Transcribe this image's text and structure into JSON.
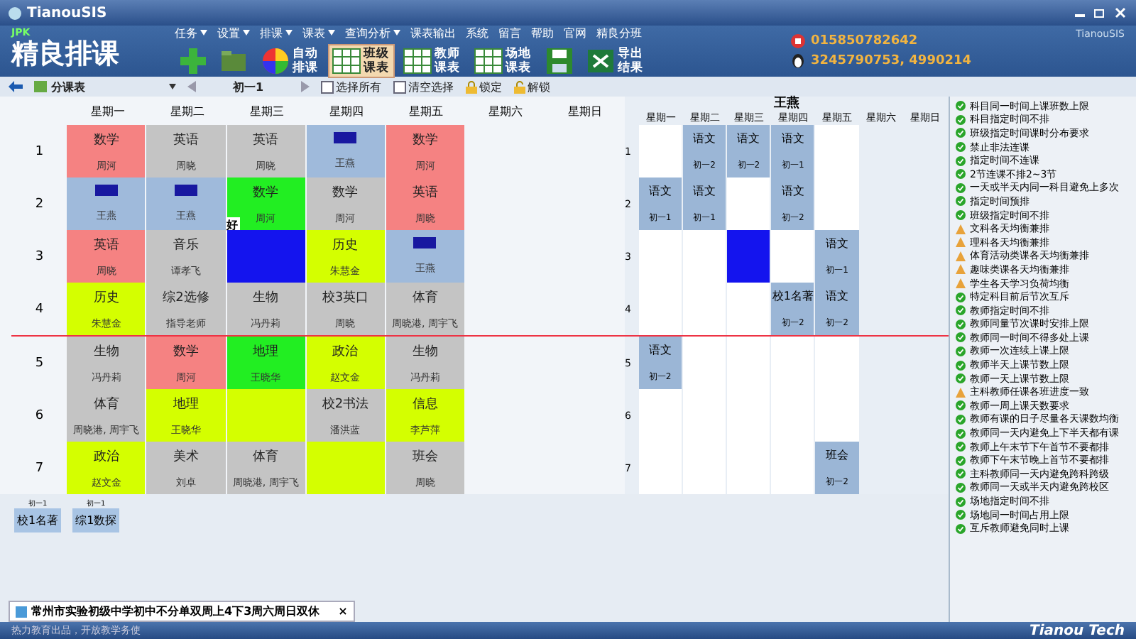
{
  "window": {
    "title": "TianouSIS",
    "title_right": "TianouSIS"
  },
  "logo": {
    "badge": "JPK",
    "name": "精良排课"
  },
  "menu": [
    {
      "label": "任务",
      "dropdown": true
    },
    {
      "label": "设置",
      "dropdown": true
    },
    {
      "label": "排课",
      "dropdown": true
    },
    {
      "label": "课表",
      "dropdown": true
    },
    {
      "label": "查询分析",
      "dropdown": true
    },
    {
      "label": "课表输出",
      "dropdown": false
    },
    {
      "label": "系统",
      "dropdown": false
    },
    {
      "label": "留言",
      "dropdown": false
    },
    {
      "label": "帮助",
      "dropdown": false
    },
    {
      "label": "官网",
      "dropdown": false
    },
    {
      "label": "精良分班",
      "dropdown": false
    }
  ],
  "toolbar": [
    {
      "kind": "add",
      "selected": false
    },
    {
      "kind": "open",
      "selected": false
    },
    {
      "kind": "auto",
      "label": "自动排课",
      "selected": false
    },
    {
      "kind": "grid",
      "label": "班级课表",
      "selected": true
    },
    {
      "kind": "grid",
      "label": "教师课表",
      "selected": false
    },
    {
      "kind": "grid",
      "label": "场地课表",
      "selected": false
    },
    {
      "kind": "save",
      "selected": false
    },
    {
      "kind": "excel",
      "label": "导出结果",
      "selected": false
    }
  ],
  "contacts": {
    "phone": "015850782642",
    "qq": "3245790753, 4990214"
  },
  "subbar": {
    "view": "分课表",
    "class": "初一1",
    "checkboxes": [
      {
        "label": "选择所有",
        "checked": false
      },
      {
        "label": "清空选择",
        "checked": false
      }
    ],
    "lock": "锁定",
    "unlock": "解锁"
  },
  "class_table": {
    "days": [
      "星期一",
      "星期二",
      "星期三",
      "星期四",
      "星期五",
      "星期六",
      "星期日"
    ],
    "rows": [
      {
        "label": "1",
        "cells": [
          {
            "subject": "数学",
            "teacher": "周河",
            "color": "#f58282",
            "marked": false
          },
          {
            "subject": "英语",
            "teacher": "周晓",
            "color": "#c4c4c4",
            "marked": false
          },
          {
            "subject": "英语",
            "teacher": "周晓",
            "color": "#c4c4c4",
            "marked": false
          },
          {
            "teacher": "王燕",
            "color": "#9fbadb",
            "marked": true
          },
          {
            "subject": "数学",
            "teacher": "周河",
            "color": "#f58282",
            "marked": false
          }
        ]
      },
      {
        "label": "2",
        "cells": [
          {
            "teacher": "王燕",
            "color": "#9fbadb",
            "marked": true
          },
          {
            "teacher": "王燕",
            "color": "#9fbadb",
            "marked": true
          },
          {
            "subject": "数学",
            "teacher": "周河",
            "color": "#22ee22",
            "marked": false
          },
          {
            "subject": "数学",
            "teacher": "周河",
            "color": "#c4c4c4",
            "marked": false
          },
          {
            "subject": "英语",
            "teacher": "周晓",
            "color": "#f58282",
            "marked": false
          }
        ]
      },
      {
        "label": "3",
        "cells": [
          {
            "subject": "英语",
            "teacher": "周晓",
            "color": "#f58282",
            "marked": false
          },
          {
            "subject": "音乐",
            "teacher": "谭孝飞",
            "color": "#c4c4c4",
            "marked": false
          },
          {
            "color": "#1414ee",
            "marked": false
          },
          {
            "subject": "历史",
            "teacher": "朱慧金",
            "color": "#d4ff00",
            "marked": false
          },
          {
            "teacher": "王燕",
            "color": "#9fbadb",
            "marked": true
          }
        ]
      },
      {
        "label": "4",
        "cells": [
          {
            "subject": "历史",
            "teacher": "朱慧金",
            "color": "#d4ff00",
            "marked": false
          },
          {
            "subject": "综2选修",
            "teacher": "指导老师",
            "color": "#c4c4c4",
            "marked": false
          },
          {
            "subject": "生物",
            "teacher": "冯丹莉",
            "color": "#c4c4c4",
            "marked": false
          },
          {
            "subject": "校3英口",
            "teacher": "周晓",
            "color": "#c4c4c4",
            "marked": false
          },
          {
            "subject": "体育",
            "teacher": "周晓港, 周宇飞",
            "color": "#c4c4c4",
            "marked": false
          }
        ]
      },
      {
        "label": "5",
        "cells": [
          {
            "subject": "生物",
            "teacher": "冯丹莉",
            "color": "#c4c4c4",
            "marked": false
          },
          {
            "subject": "数学",
            "teacher": "周河",
            "color": "#f58282",
            "marked": false
          },
          {
            "subject": "地理",
            "teacher": "王晓华",
            "color": "#22ee22",
            "marked": false
          },
          {
            "subject": "政治",
            "teacher": "赵文金",
            "color": "#d4ff00",
            "marked": false
          },
          {
            "subject": "生物",
            "teacher": "冯丹莉",
            "color": "#c4c4c4",
            "marked": false
          }
        ]
      },
      {
        "label": "6",
        "cells": [
          {
            "subject": "体育",
            "teacher": "周晓港, 周宇飞",
            "color": "#c4c4c4",
            "marked": false
          },
          {
            "subject": "地理",
            "teacher": "王晓华",
            "color": "#d4ff00",
            "marked": false
          },
          {
            "color": "#d4ff00",
            "marked": false
          },
          {
            "subject": "校2书法",
            "teacher": "潘洪蓝",
            "color": "#c4c4c4",
            "marked": false
          },
          {
            "subject": "信息",
            "teacher": "李芦萍",
            "color": "#d4ff00",
            "marked": false
          }
        ]
      },
      {
        "label": "7",
        "cells": [
          {
            "subject": "政治",
            "teacher": "赵文金",
            "color": "#d4ff00",
            "marked": false
          },
          {
            "subject": "美术",
            "teacher": "刘卓",
            "color": "#c4c4c4",
            "marked": false
          },
          {
            "subject": "体育",
            "teacher": "周晓港, 周宇飞",
            "color": "#c4c4c4",
            "marked": false
          },
          {
            "color": "#d4ff00",
            "marked": false
          },
          {
            "subject": "班会",
            "teacher": "周晓",
            "color": "#c4c4c4",
            "marked": false
          }
        ]
      }
    ]
  },
  "cursor_tip": "好",
  "teacher_table": {
    "title": "王燕",
    "days": [
      "星期一",
      "星期二",
      "星期三",
      "星期四",
      "星期五",
      "星期六",
      "星期日"
    ],
    "rows": [
      {
        "label": "1",
        "cells": [
          {
            "kind": "empty"
          },
          {
            "kind": "lesson",
            "subject": "语文",
            "class": "初一2"
          },
          {
            "kind": "lesson",
            "subject": "语文",
            "class": "初一2"
          },
          {
            "kind": "lesson",
            "subject": "语文",
            "class": "初一1"
          },
          {
            "kind": "empty"
          }
        ]
      },
      {
        "label": "2",
        "cells": [
          {
            "kind": "lesson",
            "subject": "语文",
            "class": "初一1"
          },
          {
            "kind": "lesson",
            "subject": "语文",
            "class": "初一1"
          },
          {
            "kind": "empty"
          },
          {
            "kind": "lesson",
            "subject": "语文",
            "class": "初一2"
          },
          {
            "kind": "empty"
          }
        ]
      },
      {
        "label": "3",
        "cells": [
          {
            "kind": "empty"
          },
          {
            "kind": "empty"
          },
          {
            "kind": "selected"
          },
          {
            "kind": "empty"
          },
          {
            "kind": "lesson",
            "subject": "语文",
            "class": "初一1"
          }
        ]
      },
      {
        "label": "4",
        "cells": [
          {
            "kind": "empty"
          },
          {
            "kind": "empty"
          },
          {
            "kind": "empty"
          },
          {
            "kind": "lesson",
            "subject": "校1名著",
            "class": "初一2"
          },
          {
            "kind": "lesson",
            "subject": "语文",
            "class": "初一2"
          }
        ]
      },
      {
        "label": "5",
        "cells": [
          {
            "kind": "lesson",
            "subject": "语文",
            "class": "初一2"
          },
          {
            "kind": "empty"
          },
          {
            "kind": "empty"
          },
          {
            "kind": "empty"
          },
          {
            "kind": "empty"
          }
        ]
      },
      {
        "label": "6",
        "cells": [
          {
            "kind": "empty"
          },
          {
            "kind": "empty"
          },
          {
            "kind": "empty"
          },
          {
            "kind": "empty"
          },
          {
            "kind": "empty"
          }
        ]
      },
      {
        "label": "7",
        "cells": [
          {
            "kind": "empty"
          },
          {
            "kind": "empty"
          },
          {
            "kind": "empty"
          },
          {
            "kind": "empty"
          },
          {
            "kind": "lesson",
            "subject": "班会",
            "class": "初一2"
          }
        ]
      }
    ]
  },
  "unplaced": [
    {
      "class": "初一1",
      "subject": "校1名著"
    },
    {
      "class": "初一1",
      "subject": "综1数探"
    }
  ],
  "rules": [
    {
      "kind": "ok",
      "label": "科目同一时间上课班数上限"
    },
    {
      "kind": "ok",
      "label": "科目指定时间不排"
    },
    {
      "kind": "ok",
      "label": "班级指定时间课时分布要求"
    },
    {
      "kind": "ok",
      "label": "禁止非法连课"
    },
    {
      "kind": "ok",
      "label": "指定时间不连课"
    },
    {
      "kind": "ok",
      "label": "2节连课不排2~3节"
    },
    {
      "kind": "ok",
      "label": "一天或半天内同一科目避免上多次"
    },
    {
      "kind": "ok",
      "label": "指定时间预排"
    },
    {
      "kind": "ok",
      "label": "班级指定时间不排"
    },
    {
      "kind": "warn",
      "label": "文科各天均衡兼排"
    },
    {
      "kind": "warn",
      "label": "理科各天均衡兼排"
    },
    {
      "kind": "warn",
      "label": "体育活动类课各天均衡兼排"
    },
    {
      "kind": "warn",
      "label": "趣味类课各天均衡兼排"
    },
    {
      "kind": "warn",
      "label": "学生各天学习负荷均衡"
    },
    {
      "kind": "ok",
      "label": "特定科目前后节次互斥"
    },
    {
      "kind": "ok",
      "label": "教师指定时间不排"
    },
    {
      "kind": "ok",
      "label": "教师同量节次课时安排上限"
    },
    {
      "kind": "ok",
      "label": "教师同一时间不得多处上课"
    },
    {
      "kind": "ok",
      "label": "教师一次连续上课上限"
    },
    {
      "kind": "ok",
      "label": "教师半天上课节数上限"
    },
    {
      "kind": "ok",
      "label": "教师一天上课节数上限"
    },
    {
      "kind": "warn",
      "label": "主科教师任课各班进度一致"
    },
    {
      "kind": "ok",
      "label": "教师一周上课天数要求"
    },
    {
      "kind": "ok",
      "label": "教师有课的日子尽量各天课数均衡"
    },
    {
      "kind": "ok",
      "label": "教师同一天内避免上下半天都有课"
    },
    {
      "kind": "ok",
      "label": "教师上午末节下午首节不要都排"
    },
    {
      "kind": "ok",
      "label": "教师下午末节晚上首节不要都排"
    },
    {
      "kind": "ok",
      "label": "主科教师同一天内避免跨科跨级"
    },
    {
      "kind": "ok",
      "label": "教师同一天或半天内避免跨校区"
    },
    {
      "kind": "ok",
      "label": "场地指定时间不排"
    },
    {
      "kind": "ok",
      "label": "场地同一时间占用上限"
    },
    {
      "kind": "ok",
      "label": "互斥教师避免同时上课"
    }
  ],
  "document_tab": {
    "title": "常州市实验初级中学初中不分单双周上4下3周六周日双休",
    "close": "×"
  },
  "status_bar": {
    "text": "热力教育出品，开放教学务使",
    "brand": "Tianou Tech"
  }
}
